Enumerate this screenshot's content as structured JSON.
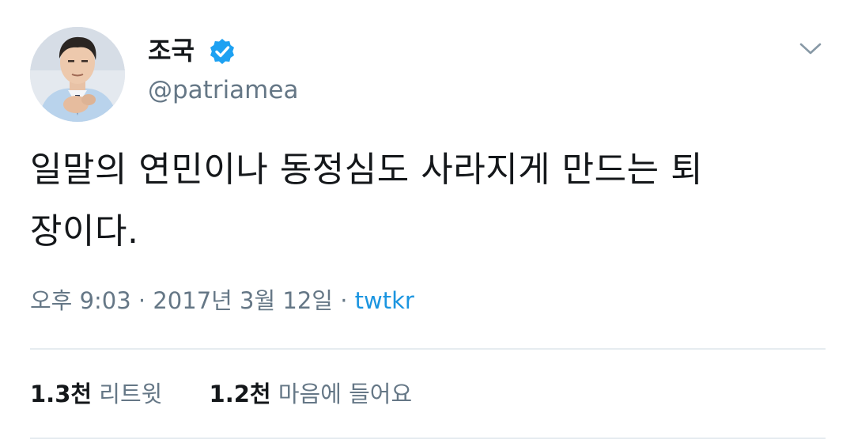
{
  "user": {
    "display_name": "조국",
    "handle": "@patriamea",
    "verified": true,
    "avatar": "profile-photo"
  },
  "tweet": {
    "text_line1": "일말의 연민이나 동정심도 사라지게 만드는 퇴",
    "text_line2": "장이다.",
    "time": "오후 9:03",
    "separator": " · ",
    "date": "2017년 3월 12일",
    "source": "twtkr"
  },
  "stats": {
    "retweets_count": "1.3천",
    "retweets_label": "리트윗",
    "likes_count": "1.2천",
    "likes_label": "마음에 들어요"
  },
  "icons": {
    "verified": "verified-badge-icon",
    "menu": "chevron-down-icon"
  },
  "colors": {
    "text": "#14171a",
    "secondary": "#657786",
    "link": "#1b95e0",
    "verified": "#1da1f2",
    "divider": "#e6ecf0"
  }
}
